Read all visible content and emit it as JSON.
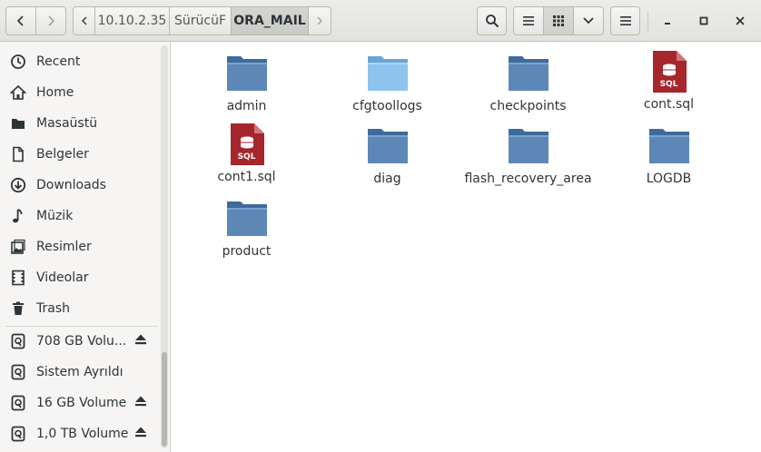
{
  "toolbar": {
    "back": "back",
    "forward": "forward",
    "path_left": "path-left",
    "path_right": "path-right"
  },
  "breadcrumb": [
    "10.10.2.35",
    "SürücüF",
    "ORA_MAIL"
  ],
  "sidebar": {
    "places": [
      {
        "label": "Recent",
        "icon": "clock-icon"
      },
      {
        "label": "Home",
        "icon": "home-icon"
      },
      {
        "label": "Masaüstü",
        "icon": "desktop-icon"
      },
      {
        "label": "Belgeler",
        "icon": "document-icon"
      },
      {
        "label": "Downloads",
        "icon": "download-icon"
      },
      {
        "label": "Müzik",
        "icon": "music-icon"
      },
      {
        "label": "Resimler",
        "icon": "pictures-icon"
      },
      {
        "label": "Videolar",
        "icon": "video-icon"
      },
      {
        "label": "Trash",
        "icon": "trash-icon"
      }
    ],
    "devices": [
      {
        "label": "708 GB Volu...",
        "eject": true
      },
      {
        "label": "Sistem Ayrıldı",
        "eject": false
      },
      {
        "label": "16 GB Volume",
        "eject": true
      },
      {
        "label": "1,0 TB Volume",
        "eject": true
      }
    ]
  },
  "files": [
    {
      "name": "admin",
      "type": "folder"
    },
    {
      "name": "cfgtoollogs",
      "type": "folder-light"
    },
    {
      "name": "checkpoints",
      "type": "folder"
    },
    {
      "name": "cont.sql",
      "type": "sql"
    },
    {
      "name": "cont1.sql",
      "type": "sql"
    },
    {
      "name": "diag",
      "type": "folder"
    },
    {
      "name": "flash_recovery_area",
      "type": "folder"
    },
    {
      "name": "LOGDB",
      "type": "folder"
    },
    {
      "name": "product",
      "type": "folder"
    }
  ],
  "sql_badge": "SQL",
  "colors": {
    "folder": "#5d87b6",
    "folder_light": "#8ec3ee",
    "sql": "#a5262b",
    "accent": "#4a90d9"
  }
}
